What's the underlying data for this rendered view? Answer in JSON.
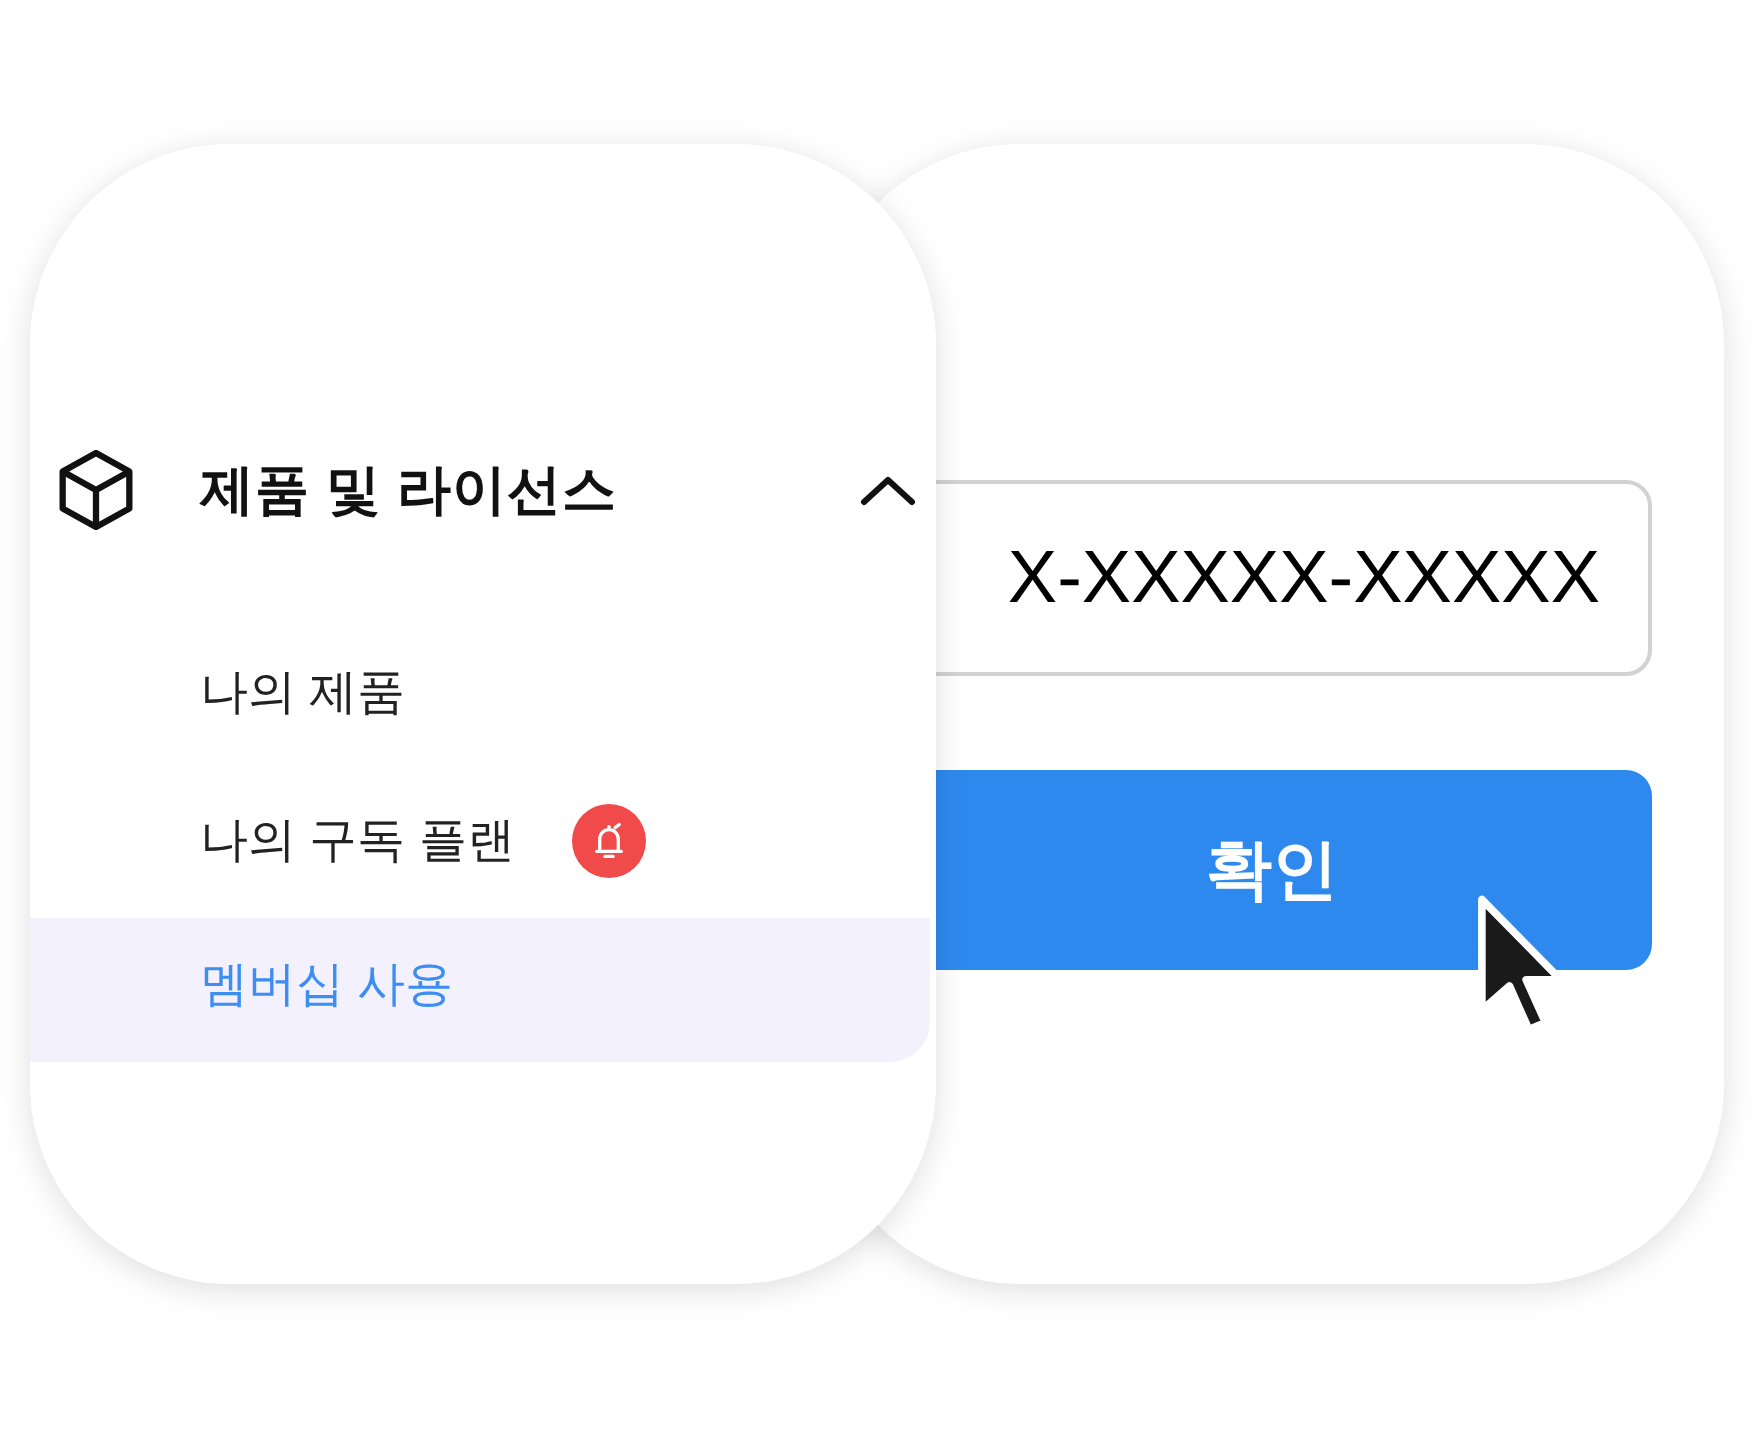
{
  "menu": {
    "section": {
      "title": "제품 및 라이선스",
      "expanded": true
    },
    "items": [
      {
        "label": "나의 제품",
        "selected": false,
        "notification": false
      },
      {
        "label": "나의 구독 플랜",
        "selected": false,
        "notification": true
      },
      {
        "label": "멤버십 사용",
        "selected": true,
        "notification": false
      }
    ]
  },
  "license_form": {
    "key_field": {
      "value": "X-XXXXX-XXXXX"
    },
    "confirm_button": {
      "label": "확인"
    }
  }
}
